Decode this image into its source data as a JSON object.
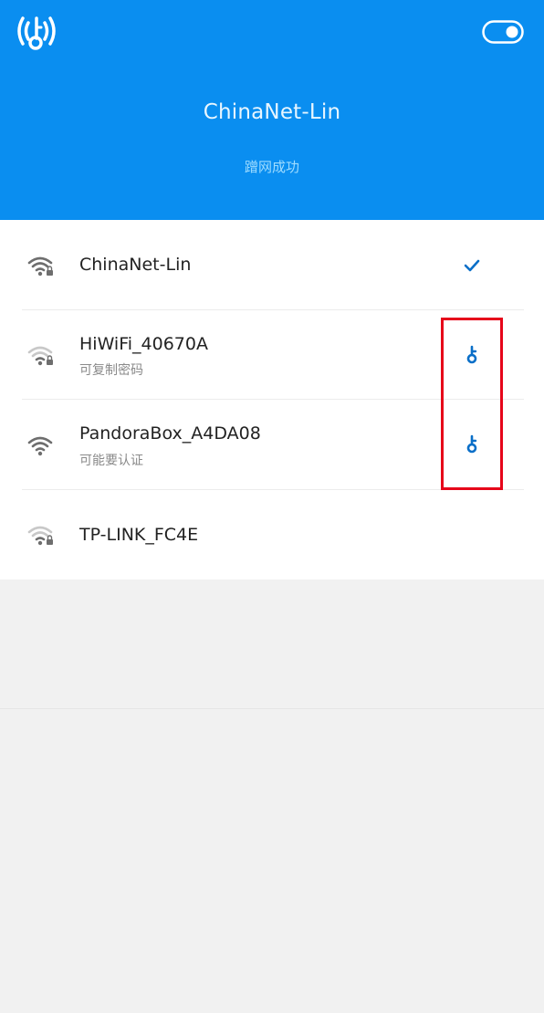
{
  "header": {
    "title": "ChinaNet-Lin",
    "status": "蹭网成功",
    "background": "#0a8ef0",
    "logo_icon": "wifi-key-logo-icon",
    "toggle_icon": "toggle-switch-icon",
    "toggle_on": true
  },
  "networks": [
    {
      "ssid": "ChinaNet-Lin",
      "subtitle": "",
      "signal": "full",
      "locked": true,
      "action_icon": "checkmark-icon",
      "connected": true
    },
    {
      "ssid": "HiWiFi_40670A",
      "subtitle": "可复制密码",
      "signal": "weak",
      "locked": true,
      "action_icon": "key-icon",
      "connected": false
    },
    {
      "ssid": "PandoraBox_A4DA08",
      "subtitle": "可能要认证",
      "signal": "full",
      "locked": false,
      "action_icon": "key-icon",
      "connected": false
    },
    {
      "ssid": "TP-LINK_FC4E",
      "subtitle": "",
      "signal": "weak",
      "locked": true,
      "action_icon": "",
      "connected": false
    }
  ],
  "colors": {
    "accent": "#0a8ef0",
    "action_blue": "#0a6fc8",
    "highlight_red": "#e6051a",
    "signal_dark": "#6e6e6e",
    "signal_light": "#c8c8c8"
  }
}
